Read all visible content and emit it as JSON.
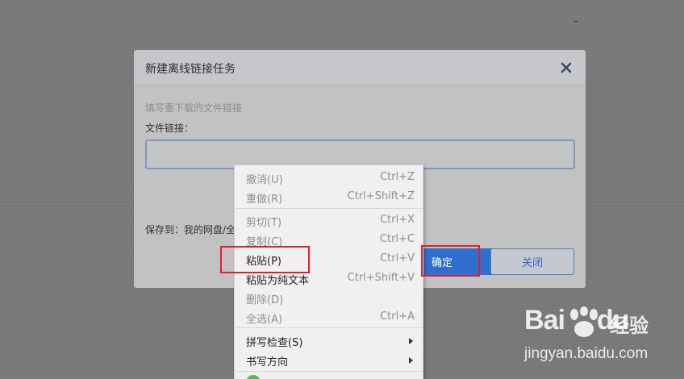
{
  "dialog": {
    "title": "新建离线链接任务",
    "hint": "填写要下载的文件链接",
    "field_label": "文件链接：",
    "input_value": "",
    "save_to": "保存到：我的网盘/全",
    "confirm_label": "确定",
    "cancel_label": "关闭"
  },
  "context_menu": {
    "items": [
      {
        "label": "撤消(U)",
        "shortcut": "Ctrl+Z"
      },
      {
        "label": "重做(R)",
        "shortcut": "Ctrl+Shift+Z"
      },
      {
        "label": "剪切(T)",
        "shortcut": "Ctrl+X"
      },
      {
        "label": "复制(C)",
        "shortcut": "Ctrl+C"
      },
      {
        "label": "粘贴(P)",
        "shortcut": "Ctrl+V"
      },
      {
        "label": "粘贴为纯文本",
        "shortcut": "Ctrl+Shift+V"
      },
      {
        "label": "删除(D)",
        "shortcut": ""
      },
      {
        "label": "全选(A)",
        "shortcut": "Ctrl+A"
      },
      {
        "label": "拼写检查(S)",
        "shortcut": ""
      },
      {
        "label": "书写方向",
        "shortcut": ""
      },
      {
        "label": "",
        "shortcut": ""
      }
    ]
  },
  "watermark": {
    "logo": "Bai",
    "logo_tail": "du",
    "sub": "经验",
    "url": "jingyan.baidu.com"
  },
  "colors": {
    "highlight_box": "#e0202a",
    "confirm_button": "#2f6fce"
  }
}
